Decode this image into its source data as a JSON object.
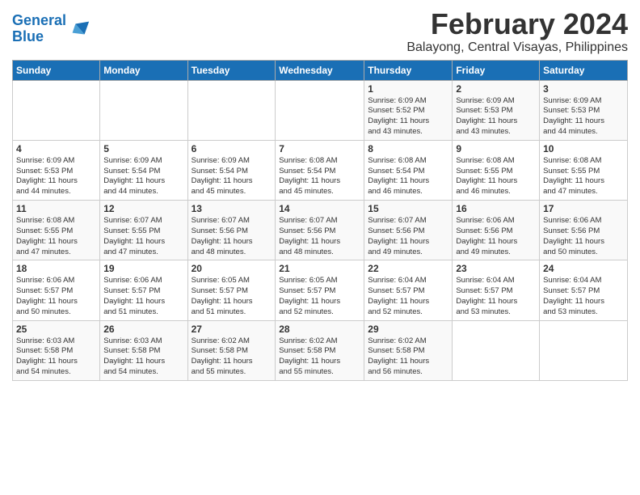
{
  "logo": {
    "line1": "General",
    "line2": "Blue"
  },
  "title": "February 2024",
  "location": "Balayong, Central Visayas, Philippines",
  "days_of_week": [
    "Sunday",
    "Monday",
    "Tuesday",
    "Wednesday",
    "Thursday",
    "Friday",
    "Saturday"
  ],
  "weeks": [
    [
      {
        "day": "",
        "info": ""
      },
      {
        "day": "",
        "info": ""
      },
      {
        "day": "",
        "info": ""
      },
      {
        "day": "",
        "info": ""
      },
      {
        "day": "1",
        "info": "Sunrise: 6:09 AM\nSunset: 5:52 PM\nDaylight: 11 hours\nand 43 minutes."
      },
      {
        "day": "2",
        "info": "Sunrise: 6:09 AM\nSunset: 5:53 PM\nDaylight: 11 hours\nand 43 minutes."
      },
      {
        "day": "3",
        "info": "Sunrise: 6:09 AM\nSunset: 5:53 PM\nDaylight: 11 hours\nand 44 minutes."
      }
    ],
    [
      {
        "day": "4",
        "info": "Sunrise: 6:09 AM\nSunset: 5:53 PM\nDaylight: 11 hours\nand 44 minutes."
      },
      {
        "day": "5",
        "info": "Sunrise: 6:09 AM\nSunset: 5:54 PM\nDaylight: 11 hours\nand 44 minutes."
      },
      {
        "day": "6",
        "info": "Sunrise: 6:09 AM\nSunset: 5:54 PM\nDaylight: 11 hours\nand 45 minutes."
      },
      {
        "day": "7",
        "info": "Sunrise: 6:08 AM\nSunset: 5:54 PM\nDaylight: 11 hours\nand 45 minutes."
      },
      {
        "day": "8",
        "info": "Sunrise: 6:08 AM\nSunset: 5:54 PM\nDaylight: 11 hours\nand 46 minutes."
      },
      {
        "day": "9",
        "info": "Sunrise: 6:08 AM\nSunset: 5:55 PM\nDaylight: 11 hours\nand 46 minutes."
      },
      {
        "day": "10",
        "info": "Sunrise: 6:08 AM\nSunset: 5:55 PM\nDaylight: 11 hours\nand 47 minutes."
      }
    ],
    [
      {
        "day": "11",
        "info": "Sunrise: 6:08 AM\nSunset: 5:55 PM\nDaylight: 11 hours\nand 47 minutes."
      },
      {
        "day": "12",
        "info": "Sunrise: 6:07 AM\nSunset: 5:55 PM\nDaylight: 11 hours\nand 47 minutes."
      },
      {
        "day": "13",
        "info": "Sunrise: 6:07 AM\nSunset: 5:56 PM\nDaylight: 11 hours\nand 48 minutes."
      },
      {
        "day": "14",
        "info": "Sunrise: 6:07 AM\nSunset: 5:56 PM\nDaylight: 11 hours\nand 48 minutes."
      },
      {
        "day": "15",
        "info": "Sunrise: 6:07 AM\nSunset: 5:56 PM\nDaylight: 11 hours\nand 49 minutes."
      },
      {
        "day": "16",
        "info": "Sunrise: 6:06 AM\nSunset: 5:56 PM\nDaylight: 11 hours\nand 49 minutes."
      },
      {
        "day": "17",
        "info": "Sunrise: 6:06 AM\nSunset: 5:56 PM\nDaylight: 11 hours\nand 50 minutes."
      }
    ],
    [
      {
        "day": "18",
        "info": "Sunrise: 6:06 AM\nSunset: 5:57 PM\nDaylight: 11 hours\nand 50 minutes."
      },
      {
        "day": "19",
        "info": "Sunrise: 6:06 AM\nSunset: 5:57 PM\nDaylight: 11 hours\nand 51 minutes."
      },
      {
        "day": "20",
        "info": "Sunrise: 6:05 AM\nSunset: 5:57 PM\nDaylight: 11 hours\nand 51 minutes."
      },
      {
        "day": "21",
        "info": "Sunrise: 6:05 AM\nSunset: 5:57 PM\nDaylight: 11 hours\nand 52 minutes."
      },
      {
        "day": "22",
        "info": "Sunrise: 6:04 AM\nSunset: 5:57 PM\nDaylight: 11 hours\nand 52 minutes."
      },
      {
        "day": "23",
        "info": "Sunrise: 6:04 AM\nSunset: 5:57 PM\nDaylight: 11 hours\nand 53 minutes."
      },
      {
        "day": "24",
        "info": "Sunrise: 6:04 AM\nSunset: 5:57 PM\nDaylight: 11 hours\nand 53 minutes."
      }
    ],
    [
      {
        "day": "25",
        "info": "Sunrise: 6:03 AM\nSunset: 5:58 PM\nDaylight: 11 hours\nand 54 minutes."
      },
      {
        "day": "26",
        "info": "Sunrise: 6:03 AM\nSunset: 5:58 PM\nDaylight: 11 hours\nand 54 minutes."
      },
      {
        "day": "27",
        "info": "Sunrise: 6:02 AM\nSunset: 5:58 PM\nDaylight: 11 hours\nand 55 minutes."
      },
      {
        "day": "28",
        "info": "Sunrise: 6:02 AM\nSunset: 5:58 PM\nDaylight: 11 hours\nand 55 minutes."
      },
      {
        "day": "29",
        "info": "Sunrise: 6:02 AM\nSunset: 5:58 PM\nDaylight: 11 hours\nand 56 minutes."
      },
      {
        "day": "",
        "info": ""
      },
      {
        "day": "",
        "info": ""
      }
    ]
  ]
}
